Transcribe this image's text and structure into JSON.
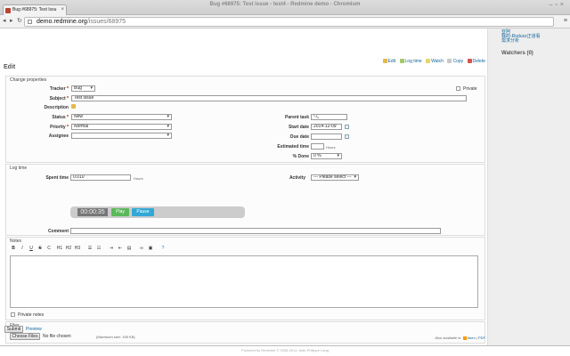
{
  "browser": {
    "tab_title": "Bug #68975: Test Issu",
    "window_title": "Bug #68975: Test issue - test4 - Redmine demo - Chromium",
    "url_host": "demo.redmine.org",
    "url_path": "/issues/68975"
  },
  "sidebar": {
    "links": [
      "亚阿",
      "我的-Roduxz正道看",
      "需求分析"
    ],
    "watchers": "Watchers (0)"
  },
  "actions": {
    "edit": "Edit",
    "log_time": "Log time",
    "watch": "Watch",
    "copy": "Copy",
    "delete": "Delete"
  },
  "page_title": "Edit",
  "properties": {
    "legend": "Change properties",
    "tracker_label": "Tracker",
    "tracker_value": "Bug",
    "private_label": "Private",
    "subject_label": "Subject",
    "subject_value": "Test issue",
    "description_label": "Description",
    "status_label": "Status",
    "status_value": "New",
    "priority_label": "Priority",
    "priority_value": "Normal",
    "assignee_label": "Assignee",
    "assignee_value": "",
    "parent_task_label": "Parent task",
    "start_date_label": "Start date",
    "start_date_value": "2014-12-09",
    "due_date_label": "Due date",
    "estimated_time_label": "Estimated time",
    "hours_unit": "Hours",
    "done_label": "% Done",
    "done_value": "0 %"
  },
  "log_time": {
    "legend": "Log time",
    "spent_time_label": "Spent time",
    "spent_time_value": "0.010",
    "hours_unit": "Hours",
    "activity_label": "Activity",
    "activity_value": "--- Please select ---",
    "timer_value": "00:00:35",
    "play_label": "Play",
    "pause_label": "Pause",
    "comment_label": "Comment"
  },
  "notes": {
    "legend": "Notes",
    "toolbar": [
      "B",
      "I",
      "U",
      "S",
      "C",
      "H1",
      "H2",
      "H3"
    ],
    "private_notes_label": "Private notes"
  },
  "files": {
    "legend": "Files",
    "choose_label": "Choose Files",
    "no_file": "No file chosen",
    "max_size": "(Maximum size: 195 KB)"
  },
  "submit_label": "Submit",
  "preview_label": "Preview",
  "also_available": "Also available in:",
  "atom_label": "Atom",
  "pdf_label": "PDF",
  "footer": "Powered by Redmine © 2006-2014 Jean-Philippe Lang",
  "colors": {
    "link": "#116699",
    "play": "#5cb85c",
    "pause": "#31a8d6"
  }
}
